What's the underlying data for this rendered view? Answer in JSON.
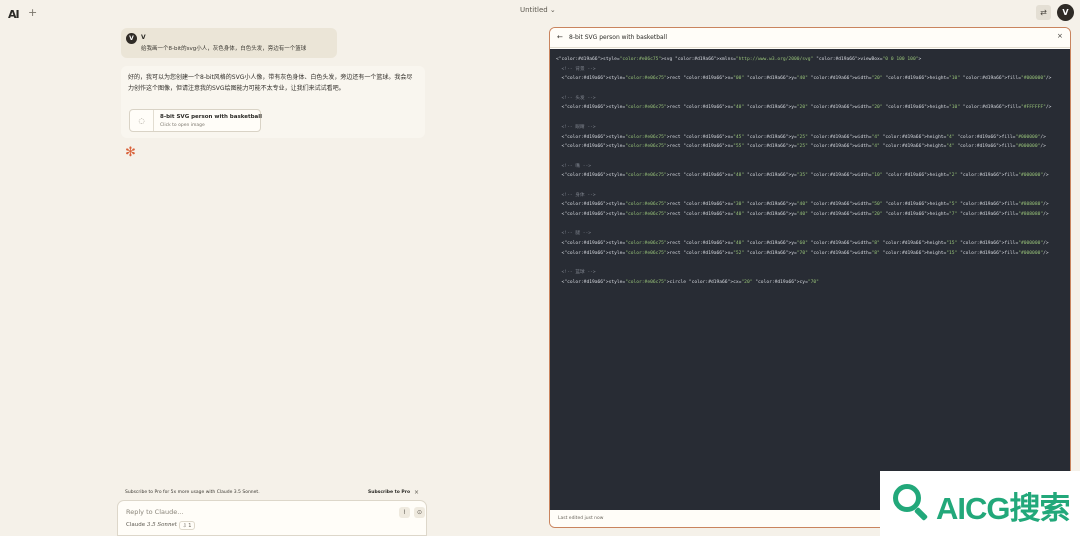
{
  "app": {
    "logo_text": "AI",
    "new_chat_icon": "plus-icon",
    "doc_title": "Untitled ⌄",
    "user_initial": "V"
  },
  "conversation": {
    "user": {
      "initial": "V",
      "name": "V",
      "text": "给我画一个8-bit的svg小人，灰色身体，白色头发，旁边有一个篮球"
    },
    "assistant": {
      "text": "好的，我可以为您创建一个8-bit风格的SVG小人像，带有灰色身体、白色头发，旁边还有一个篮球。我会尽力创作这个图像，但请注意我的SVG绘图能力可能不太专业，让我们来试试看吧。",
      "artifact": {
        "title": "8-bit SVG person with basketball",
        "subtitle": "Click to open image"
      }
    }
  },
  "promo": {
    "text": "Subscribe to Pro for 5x more usage with Claude 3.5 Sonnet.",
    "link": "Subscribe to Pro",
    "close": "×"
  },
  "composer": {
    "placeholder": "Reply to Claude...",
    "model_name": "Claude",
    "model_version": "3.5 Sonnet",
    "style_label": "⇩ 1",
    "attach_icon": "paperclip-icon",
    "send_icon": "send-icon"
  },
  "artifact_panel": {
    "title": "8-bit SVG person with basketball",
    "close": "×",
    "back": "←",
    "code_lines": [
      "<svg xmlns=\"http://www.w3.org/2000/svg\" viewBox=\"0 0 100 100\">",
      "  <!-- 背景 -->",
      "  <rect x=\"00\" y=\"40\" width=\"20\" height=\"10\" fill=\"#000000\"/>",
      "",
      "  <!-- 头发 -->",
      "  <rect x=\"40\" y=\"20\" width=\"20\" height=\"10\" fill=\"#FFFFFF\"/>",
      "",
      "  <!-- 眼睛 -->",
      "  <rect x=\"45\" y=\"25\" width=\"4\" height=\"4\" fill=\"#000000\"/>",
      "  <rect x=\"55\" y=\"25\" width=\"4\" height=\"4\" fill=\"#000000\"/>",
      "",
      "  <!-- 嘴 -->",
      "  <rect x=\"48\" y=\"35\" width=\"10\" height=\"2\" fill=\"#000000\"/>",
      "",
      "  <!-- 身体 -->",
      "  <rect x=\"30\" y=\"40\" width=\"50\" height=\"5\" fill=\"#808080\"/>",
      "  <rect x=\"40\" y=\"40\" width=\"20\" height=\"7\" fill=\"#808080\"/>",
      "",
      "  <!-- 腿 -->",
      "  <rect x=\"40\" y=\"60\" width=\"8\" height=\"15\" fill=\"#000000\"/>",
      "  <rect x=\"52\" y=\"70\" width=\"8\" height=\"15\" fill=\"#000000\"/>",
      "",
      "  <!-- 篮球 -->",
      "  <circle cx=\"20\" cy=\"70\""
    ],
    "footer": "Last edited just now"
  },
  "watermark": {
    "text": "AICG搜索"
  },
  "colors": {
    "background": "#f5f1e9",
    "code_bg": "#282c34",
    "accent": "#d9623b",
    "watermark_green": "#22a87a"
  }
}
